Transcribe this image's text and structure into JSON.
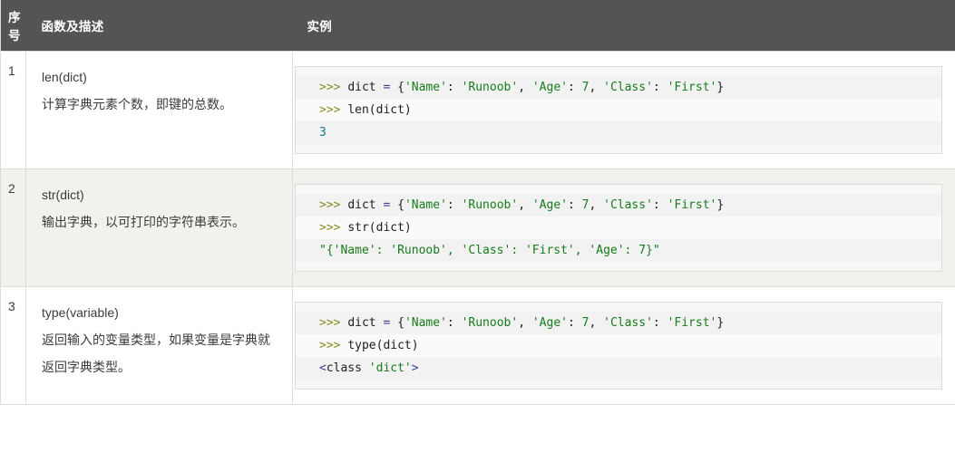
{
  "table": {
    "headers": {
      "seq": "序号",
      "description": "函数及描述",
      "example": "实例"
    },
    "colors": {
      "header_bg": "#545454",
      "header_text": "#ffffff",
      "row_bg": "#ffffff",
      "alt_row_bg": "#f2f1ec",
      "border": "#dddddd",
      "code_bg": "#f7f7f7",
      "code_border": "#dcdcdc",
      "code_stripe_odd": "#f2f2f2",
      "code_stripe_even": "#fafafa",
      "prompt": "#8a8a22",
      "string": "#177c1b",
      "number_output": "#0f7b8a",
      "operator": "#3b3b9b",
      "body_text": "#3b3b3b"
    },
    "rows": [
      {
        "seq": "1",
        "signature": "len(dict)",
        "description": "计算字典元素个数，即键的总数。",
        "code": [
          {
            "stripe": "odd",
            "tokens": [
              {
                "t": ">>> ",
                "c": "tk-prompt"
              },
              {
                "t": "dict",
                "c": "tk-plain"
              },
              {
                "t": " ",
                "c": "tk-plain"
              },
              {
                "t": "=",
                "c": "tk-op"
              },
              {
                "t": " ",
                "c": "tk-plain"
              },
              {
                "t": "{",
                "c": "tk-punct"
              },
              {
                "t": "'Name'",
                "c": "tk-str"
              },
              {
                "t": ": ",
                "c": "tk-punct"
              },
              {
                "t": "'Runoob'",
                "c": "tk-str"
              },
              {
                "t": ", ",
                "c": "tk-punct"
              },
              {
                "t": "'Age'",
                "c": "tk-str"
              },
              {
                "t": ": ",
                "c": "tk-punct"
              },
              {
                "t": "7",
                "c": "tk-num"
              },
              {
                "t": ", ",
                "c": "tk-punct"
              },
              {
                "t": "'Class'",
                "c": "tk-str"
              },
              {
                "t": ": ",
                "c": "tk-punct"
              },
              {
                "t": "'First'",
                "c": "tk-str"
              },
              {
                "t": "}",
                "c": "tk-punct"
              }
            ]
          },
          {
            "stripe": "even",
            "tokens": [
              {
                "t": ">>> ",
                "c": "tk-prompt"
              },
              {
                "t": "len(dict)",
                "c": "tk-plain"
              }
            ]
          },
          {
            "stripe": "odd",
            "tokens": [
              {
                "t": "3",
                "c": "tk-numout"
              }
            ]
          }
        ]
      },
      {
        "seq": "2",
        "signature": "str(dict)",
        "description": "输出字典，以可打印的字符串表示。",
        "code": [
          {
            "stripe": "odd",
            "tokens": [
              {
                "t": ">>> ",
                "c": "tk-prompt"
              },
              {
                "t": "dict",
                "c": "tk-plain"
              },
              {
                "t": " ",
                "c": "tk-plain"
              },
              {
                "t": "=",
                "c": "tk-op"
              },
              {
                "t": " ",
                "c": "tk-plain"
              },
              {
                "t": "{",
                "c": "tk-punct"
              },
              {
                "t": "'Name'",
                "c": "tk-str"
              },
              {
                "t": ": ",
                "c": "tk-punct"
              },
              {
                "t": "'Runoob'",
                "c": "tk-str"
              },
              {
                "t": ", ",
                "c": "tk-punct"
              },
              {
                "t": "'Age'",
                "c": "tk-str"
              },
              {
                "t": ": ",
                "c": "tk-punct"
              },
              {
                "t": "7",
                "c": "tk-num"
              },
              {
                "t": ", ",
                "c": "tk-punct"
              },
              {
                "t": "'Class'",
                "c": "tk-str"
              },
              {
                "t": ": ",
                "c": "tk-punct"
              },
              {
                "t": "'First'",
                "c": "tk-str"
              },
              {
                "t": "}",
                "c": "tk-punct"
              }
            ]
          },
          {
            "stripe": "even",
            "tokens": [
              {
                "t": ">>> ",
                "c": "tk-prompt"
              },
              {
                "t": "str(dict)",
                "c": "tk-plain"
              }
            ]
          },
          {
            "stripe": "odd",
            "tokens": [
              {
                "t": "\"{'Name': 'Runoob', 'Class': 'First', 'Age': 7}\"",
                "c": "tk-out"
              }
            ]
          }
        ]
      },
      {
        "seq": "3",
        "signature": "type(variable)",
        "description": "返回输入的变量类型，如果变量是字典就返回字典类型。",
        "code": [
          {
            "stripe": "odd",
            "tokens": [
              {
                "t": ">>> ",
                "c": "tk-prompt"
              },
              {
                "t": "dict",
                "c": "tk-plain"
              },
              {
                "t": " ",
                "c": "tk-plain"
              },
              {
                "t": "=",
                "c": "tk-op"
              },
              {
                "t": " ",
                "c": "tk-plain"
              },
              {
                "t": "{",
                "c": "tk-punct"
              },
              {
                "t": "'Name'",
                "c": "tk-str"
              },
              {
                "t": ": ",
                "c": "tk-punct"
              },
              {
                "t": "'Runoob'",
                "c": "tk-str"
              },
              {
                "t": ", ",
                "c": "tk-punct"
              },
              {
                "t": "'Age'",
                "c": "tk-str"
              },
              {
                "t": ": ",
                "c": "tk-punct"
              },
              {
                "t": "7",
                "c": "tk-num"
              },
              {
                "t": ", ",
                "c": "tk-punct"
              },
              {
                "t": "'Class'",
                "c": "tk-str"
              },
              {
                "t": ": ",
                "c": "tk-punct"
              },
              {
                "t": "'First'",
                "c": "tk-str"
              },
              {
                "t": "}",
                "c": "tk-punct"
              }
            ]
          },
          {
            "stripe": "even",
            "tokens": [
              {
                "t": ">>> ",
                "c": "tk-prompt"
              },
              {
                "t": "type(dict)",
                "c": "tk-plain"
              }
            ]
          },
          {
            "stripe": "odd",
            "tokens": [
              {
                "t": "<",
                "c": "tk-op"
              },
              {
                "t": "class ",
                "c": "tk-plain"
              },
              {
                "t": "'dict'",
                "c": "tk-str"
              },
              {
                "t": ">",
                "c": "tk-op"
              }
            ]
          }
        ]
      }
    ]
  }
}
